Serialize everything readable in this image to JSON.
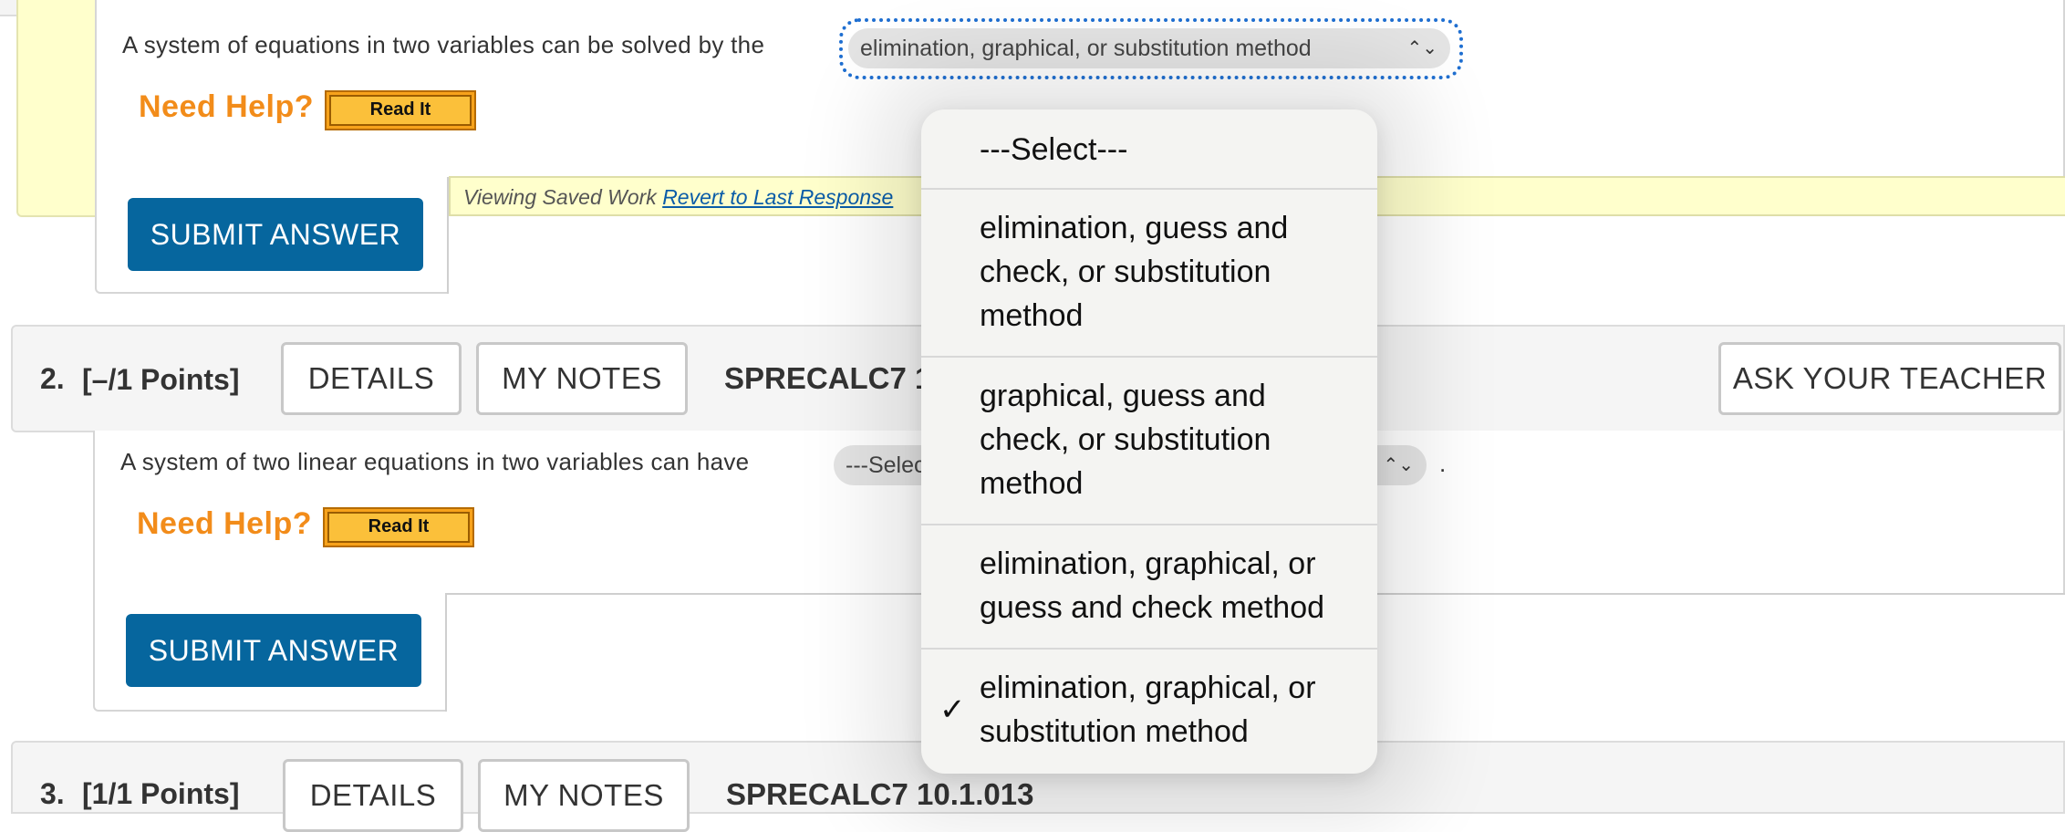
{
  "question1": {
    "prompt": "A system of equations in two variables can be solved by the",
    "selected_value": "elimination, graphical, or substitution method",
    "select_arrows": "⌃⌄",
    "need_help": "Need Help?",
    "read_it": "Read It",
    "submit": "SUBMIT ANSWER",
    "saved_text": "Viewing Saved Work ",
    "revert_link": "Revert to Last Response"
  },
  "question2": {
    "number": "2.",
    "points": "[–/1 Points]",
    "details": "DETAILS",
    "my_notes": "MY NOTES",
    "code": "SPRECALC7 10",
    "ask_teacher": "ASK YOUR TEACHER",
    "prompt": "A system of two linear equations in two variables can have",
    "selected_value": "---Select",
    "after_select": ".",
    "need_help": "Need Help?",
    "read_it": "Read It",
    "submit": "SUBMIT ANSWER"
  },
  "question3": {
    "number": "3.",
    "points": "[1/1 Points]",
    "details": "DETAILS",
    "my_notes": "MY NOTES",
    "code": "SPRECALC7 10.1.013"
  },
  "dropdown": {
    "options": [
      {
        "label": "---Select---",
        "checked": false
      },
      {
        "label": "elimination, guess and check, or substitution method",
        "checked": false
      },
      {
        "label": "graphical, guess and check, or substitution method",
        "checked": false
      },
      {
        "label": "elimination, graphical, or guess and check method",
        "checked": false
      },
      {
        "label": "elimination, graphical, or substitution method",
        "checked": true
      }
    ],
    "check_glyph": "✓"
  },
  "colors": {
    "accent_blue": "#06669e",
    "help_orange": "#f28c1a",
    "saved_yellow": "#ffffcc",
    "focus_ring": "#1f6fd1"
  }
}
